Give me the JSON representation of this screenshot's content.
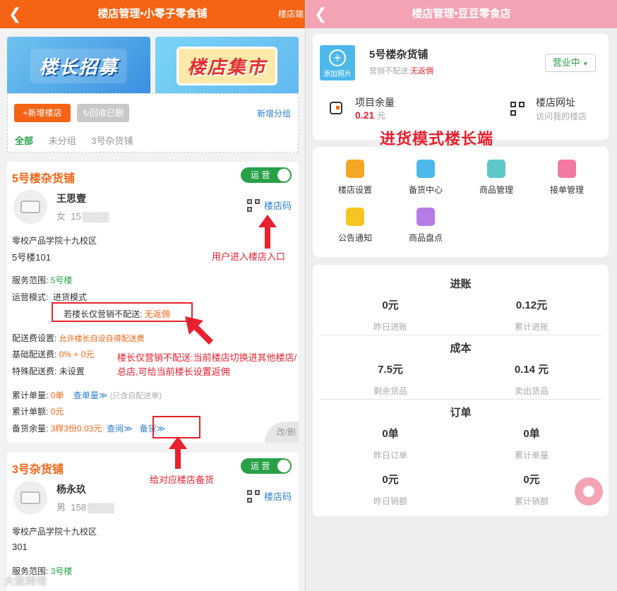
{
  "left": {
    "title": "楼店管理•小零子零食铺",
    "right_label": "楼店端",
    "banners": [
      "楼长招募",
      "楼店集市"
    ],
    "add_store_label": "+新增楼店",
    "recycle_label": "↻回收已删",
    "add_group_label": "新增分组",
    "tabs": [
      "全部",
      "未分组",
      "3号杂货铺"
    ],
    "card1": {
      "title": "5号楼杂货铺",
      "toggle": "运 营",
      "user_name": "王思壹",
      "user_gender": "女",
      "user_phone": "15",
      "qr_label": "楼店码",
      "address1": "零校产品学院十九校区",
      "address2": "5号楼101",
      "service_label": "服务范围:",
      "service_value": "5号楼",
      "mode_label": "运营模式:",
      "mode_value": "进货模式",
      "rebate_label": "若楼长仅营销不配送:",
      "rebate_value": "无返佣",
      "fee_setting_label": "配送费设置:",
      "fee_setting_value": "允许楼长自设自得配送费",
      "base_fee_label": "基础配送费:",
      "base_fee_value": "0% + 0元",
      "special_fee_label": "特殊配送费:",
      "special_fee_value": "未设置",
      "orders_label": "累计单量:",
      "orders_value": "0单",
      "orders_link": "查单量≫",
      "orders_note": "(只含自配送单)",
      "amount_label": "累计单额:",
      "amount_value": "0元",
      "stock_label": "备货余量:",
      "stock_value": "3样3份0.03元",
      "stock_query": "查阅≫",
      "stock_restock": "备货≫",
      "corner": "改/删"
    },
    "card2": {
      "title": "3号杂货铺",
      "toggle": "运 营",
      "user_name": "杨永玖",
      "user_gender": "男",
      "user_phone": "158",
      "qr_label": "楼店码",
      "address1": "零校产品学院十九校区",
      "address2": "301",
      "service_label": "服务范围:",
      "service_value": "3号楼"
    },
    "notes": {
      "entry": "用户进入楼店入口",
      "rebate": "楼长仅营销不配送:当前楼店切换进其他楼店/总店,可给当前楼长设置返佣",
      "restock": "给对应楼店备货"
    },
    "watermark": "大数跨境"
  },
  "right": {
    "title": "楼店管理•豆豆零食店",
    "add_photo": "添加照片",
    "shop_name": "5号楼杂货铺",
    "shop_sub_prefix": "营销不配送:",
    "shop_sub_value": "无返佣",
    "status": "营业中",
    "balance_label": "项目余量",
    "balance_value": "0.21",
    "balance_unit": "元",
    "url_label": "楼店网址",
    "url_sub": "访问我的楼店",
    "big_note": "进货模式楼长端",
    "menu": [
      {
        "label": "楼店设置",
        "icon": "store-settings-icon",
        "color": "#f5a623"
      },
      {
        "label": "备货中心",
        "icon": "restock-center-icon",
        "color": "#4db8ea"
      },
      {
        "label": "商品管理",
        "icon": "product-manage-icon",
        "color": "#5ec8c8"
      },
      {
        "label": "接单管理",
        "icon": "order-manage-icon",
        "color": "#f27aa0"
      },
      {
        "label": "公告通知",
        "icon": "announcement-icon",
        "color": "#f5c623"
      },
      {
        "label": "商品盘点",
        "icon": "inventory-icon",
        "color": "#b57ce8"
      }
    ],
    "sections": [
      {
        "title": "进账",
        "items": [
          {
            "value": "0元",
            "label": "昨日进账"
          },
          {
            "value": "0.12元",
            "label": "累计进账"
          }
        ]
      },
      {
        "title": "成本",
        "items": [
          {
            "value": "7.5元",
            "label": "剩余货品"
          },
          {
            "value": "0.14 元",
            "label": "卖出货品"
          }
        ]
      },
      {
        "title": "订单",
        "items": [
          {
            "value": "0单",
            "label": "昨日订单"
          },
          {
            "value": "0单",
            "label": "累计单量"
          },
          {
            "value": "0元",
            "label": "昨日销额"
          },
          {
            "value": "0元",
            "label": "累计销额"
          }
        ]
      }
    ]
  },
  "colors": {
    "left_accent": "#f56414",
    "right_accent": "#f4a3b5",
    "green": "#28a047",
    "red": "#e8212f",
    "link": "#2d7fd0"
  }
}
